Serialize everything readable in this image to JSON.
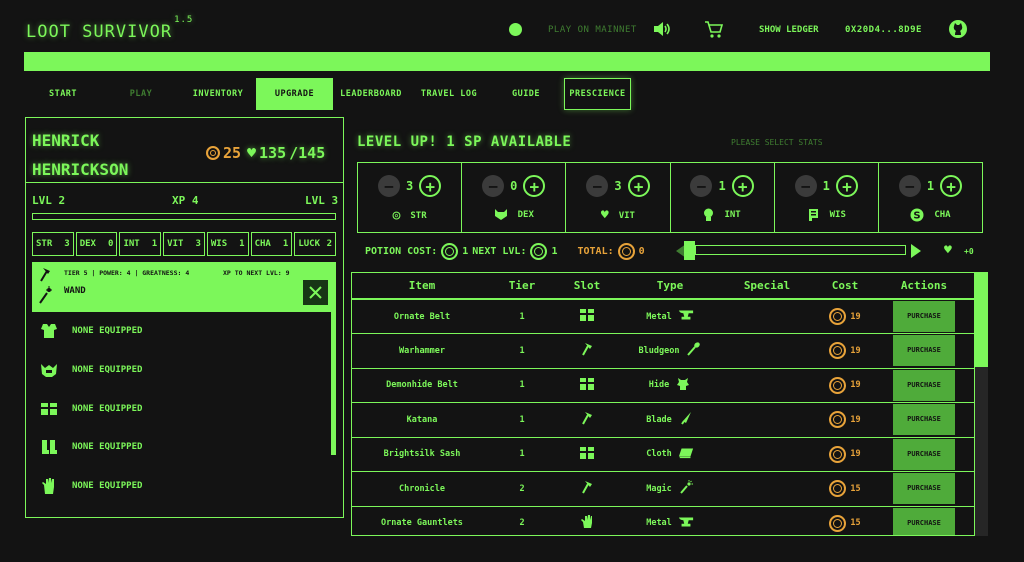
{
  "header": {
    "logo": "LOOT SURVIV",
    "logo_special": "O",
    "logo_tail": "R",
    "logo_version": "1.5",
    "play_mainnet": "PLAY ON MAINNET",
    "show_ledger": "SHOW LEDGER",
    "wallet": "0X20D4...8D9E"
  },
  "nav": {
    "tabs": [
      {
        "label": "START",
        "state": "normal"
      },
      {
        "label": "PLAY",
        "state": "dim"
      },
      {
        "label": "INVENTORY",
        "state": "normal"
      },
      {
        "label": "UPGRADE",
        "state": "active"
      },
      {
        "label": "LEADERBOARD",
        "state": "normal"
      },
      {
        "label": "TRAVEL LOG",
        "state": "normal"
      },
      {
        "label": "GUIDE",
        "state": "normal"
      },
      {
        "label": "PRESCIENCE",
        "state": "outlined"
      }
    ]
  },
  "hero": {
    "first_name": "HENRICK",
    "last_name": "HENRICKSON",
    "gold": "25",
    "health": "135",
    "max_health": "/145",
    "level_left": "LVL 2",
    "xp": "XP 4",
    "level_right": "LVL 3",
    "xp_progress": 0,
    "stats": [
      {
        "name": "STR",
        "value": "3"
      },
      {
        "name": "DEX",
        "value": "0"
      },
      {
        "name": "INT",
        "value": "1"
      },
      {
        "name": "VIT",
        "value": "3"
      },
      {
        "name": "WIS",
        "value": "1"
      },
      {
        "name": "CHA",
        "value": "1"
      },
      {
        "name": "LUCK",
        "value": "2"
      }
    ],
    "equipped_weapon": {
      "info": "TIER 5 | POWER: 4 | GREATNESS: 4",
      "xp_to_next": "XP TO NEXT LVL: 9",
      "name": "WAND"
    },
    "empty_slots": [
      {
        "icon": "chest-armor-icon",
        "label": "NONE EQUIPPED"
      },
      {
        "icon": "helmet-icon",
        "label": "NONE EQUIPPED"
      },
      {
        "icon": "waist-icon",
        "label": "NONE EQUIPPED"
      },
      {
        "icon": "boots-icon",
        "label": "NONE EQUIPPED"
      },
      {
        "icon": "hand-icon",
        "label": "NONE EQUIPPED"
      }
    ]
  },
  "upgrade": {
    "title": "LEVEL UP!  1 SP AVAILABLE",
    "hint": "PLEASE SELECT STATS",
    "stat_upgrades": [
      {
        "name": "STR",
        "value": "3",
        "icon": "strength-icon"
      },
      {
        "name": "DEX",
        "value": "0",
        "icon": "dexterity-icon"
      },
      {
        "name": "VIT",
        "value": "3",
        "icon": "vitality-icon"
      },
      {
        "name": "INT",
        "value": "1",
        "icon": "intelligence-icon"
      },
      {
        "name": "WIS",
        "value": "1",
        "icon": "wisdom-icon"
      },
      {
        "name": "CHA",
        "value": "1",
        "icon": "charisma-icon"
      }
    ],
    "potion_cost_label": "POTION COST:",
    "potion_cost": "1",
    "next_lvl_label": "NEXT LVL:",
    "next_lvl_cost": "1",
    "total_label": "TOTAL:",
    "total": "0",
    "heal_amount": "+0",
    "slider_level": 0
  },
  "market": {
    "columns": [
      "Item",
      "Tier",
      "Slot",
      "Type",
      "Special",
      "Cost",
      "Actions"
    ],
    "rows": [
      {
        "item": "Ornate Belt",
        "tier": "1",
        "slot": "waist-icon",
        "type": "Metal",
        "type_icon": "anvil-icon",
        "special": "",
        "cost": "19",
        "action": "PURCHASE"
      },
      {
        "item": "Warhammer",
        "tier": "1",
        "slot": "weapon-icon",
        "type": "Bludgeon",
        "type_icon": "club-icon",
        "special": "",
        "cost": "19",
        "action": "PURCHASE"
      },
      {
        "item": "Demonhide Belt",
        "tier": "1",
        "slot": "waist-icon",
        "type": "Hide",
        "type_icon": "hide-icon",
        "special": "",
        "cost": "19",
        "action": "PURCHASE"
      },
      {
        "item": "Katana",
        "tier": "1",
        "slot": "weapon-icon",
        "type": "Blade",
        "type_icon": "blade-icon",
        "special": "",
        "cost": "19",
        "action": "PURCHASE"
      },
      {
        "item": "Brightsilk Sash",
        "tier": "1",
        "slot": "waist-icon",
        "type": "Cloth",
        "type_icon": "cloth-icon",
        "special": "",
        "cost": "19",
        "action": "PURCHASE"
      },
      {
        "item": "Chronicle",
        "tier": "2",
        "slot": "weapon-icon",
        "type": "Magic",
        "type_icon": "magic-wand-icon",
        "special": "",
        "cost": "15",
        "action": "PURCHASE"
      },
      {
        "item": "Ornate Gauntlets",
        "tier": "2",
        "slot": "hand-icon",
        "type": "Metal",
        "type_icon": "anvil-icon",
        "special": "",
        "cost": "15",
        "action": "PURCHASE"
      }
    ]
  },
  "colors": {
    "accent": "#7CF75A",
    "gold": "#E8A33A",
    "background": "#131313",
    "button": "#4fab3a"
  }
}
